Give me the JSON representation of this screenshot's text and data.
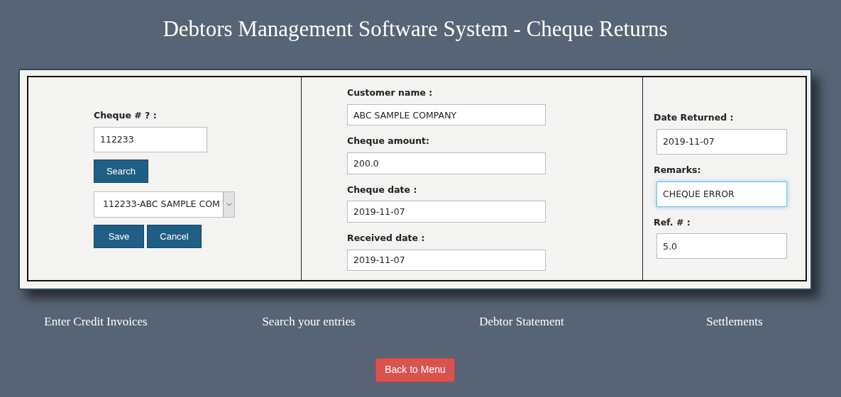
{
  "title": "Debtors Management Software System - Cheque Returns",
  "search_panel": {
    "cheque_label": "Cheque # ? :",
    "cheque_value": "112233",
    "search_button": "Search",
    "cheque_select": "112233-ABC SAMPLE COM",
    "buttons": [
      "Save",
      "Cancel"
    ]
  },
  "details": [
    {
      "label": "Customer name :",
      "value": "ABC SAMPLE COMPANY"
    },
    {
      "label": "Cheque amount:",
      "value": "200.0"
    },
    {
      "label": "Cheque date :",
      "value": "2019-11-07"
    },
    {
      "label": "Received date :",
      "value": "2019-11-07"
    }
  ],
  "return_details": [
    {
      "label": "Date Returned :",
      "value": "2019-11-07",
      "focused": false
    },
    {
      "label": "Remarks:",
      "value": "CHEQUE ERROR",
      "focused": true
    },
    {
      "label": "Ref. # :",
      "value": "5.0",
      "focused": false
    }
  ],
  "links": [
    "Enter Credit Invoices",
    "Search your entries",
    "Debtor Statement",
    "Settlements"
  ],
  "back_button": "Back to Menu"
}
